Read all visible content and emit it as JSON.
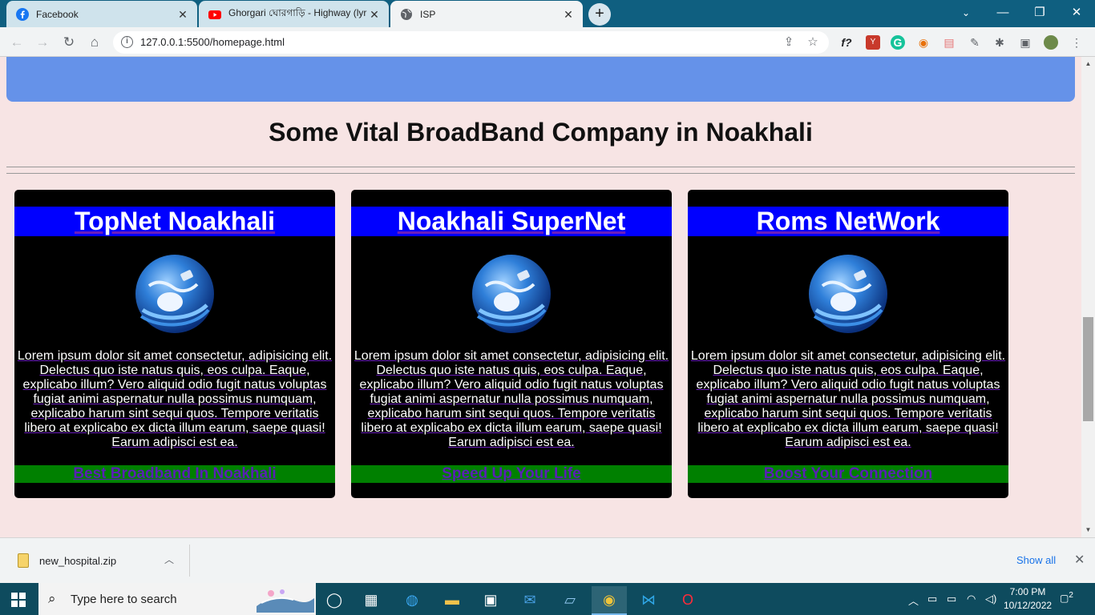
{
  "browser": {
    "tabs": [
      {
        "title": "Facebook",
        "favicon": "facebook-icon",
        "color": "#1877f2",
        "active": false
      },
      {
        "title": "Ghorgari ঘোরগাড়ি - Highway (lyr",
        "favicon": "youtube-icon",
        "color": "#ff0000",
        "active": false
      },
      {
        "title": "ISP",
        "favicon": "globe-icon",
        "color": "#5f6368",
        "active": true
      }
    ],
    "url": "127.0.0.1:5500/homepage.html"
  },
  "page": {
    "heading": "Some Vital BroadBand Company in Noakhali",
    "cards": [
      {
        "title": "TopNet Noakhali",
        "description": "Lorem ipsum dolor sit amet consectetur, adipisicing elit. Delectus quo iste natus quis, eos culpa. Eaque, explicabo illum? Vero aliquid odio fugit natus voluptas fugiat animi aspernatur nulla possimus numquam, explicabo harum sint sequi quos. Tempore veritatis libero at explicabo ex dicta illum earum, saepe quasi! Earum adipisci est ea.",
        "footer_link": "Best Broadband In Noakhali"
      },
      {
        "title": "Noakhali SuperNet",
        "description": "Lorem ipsum dolor sit amet consectetur, adipisicing elit. Delectus quo iste natus quis, eos culpa. Eaque, explicabo illum? Vero aliquid odio fugit natus voluptas fugiat animi aspernatur nulla possimus numquam, explicabo harum sint sequi quos. Tempore veritatis libero at explicabo ex dicta illum earum, saepe quasi! Earum adipisci est ea.",
        "footer_link": "Speed Up Your Life"
      },
      {
        "title": "Roms NetWork",
        "description": "Lorem ipsum dolor sit amet consectetur, adipisicing elit. Delectus quo iste natus quis, eos culpa. Eaque, explicabo illum? Vero aliquid odio fugit natus voluptas fugiat animi aspernatur nulla possimus numquam, explicabo harum sint sequi quos. Tempore veritatis libero at explicabo ex dicta illum earum, saepe quasi! Earum adipisci est ea.",
        "footer_link": "Boost Your Connection"
      }
    ]
  },
  "download_shelf": {
    "filename": "new_hospital.zip",
    "show_all": "Show all"
  },
  "taskbar": {
    "search_placeholder": "Type here to search",
    "time": "7:00 PM",
    "date": "10/12/2022",
    "notification_count": "2"
  },
  "colors": {
    "page_bg": "#f7e4e4",
    "hero": "#6592e9",
    "card_header": "#0000ff",
    "card_footer": "#008000"
  }
}
